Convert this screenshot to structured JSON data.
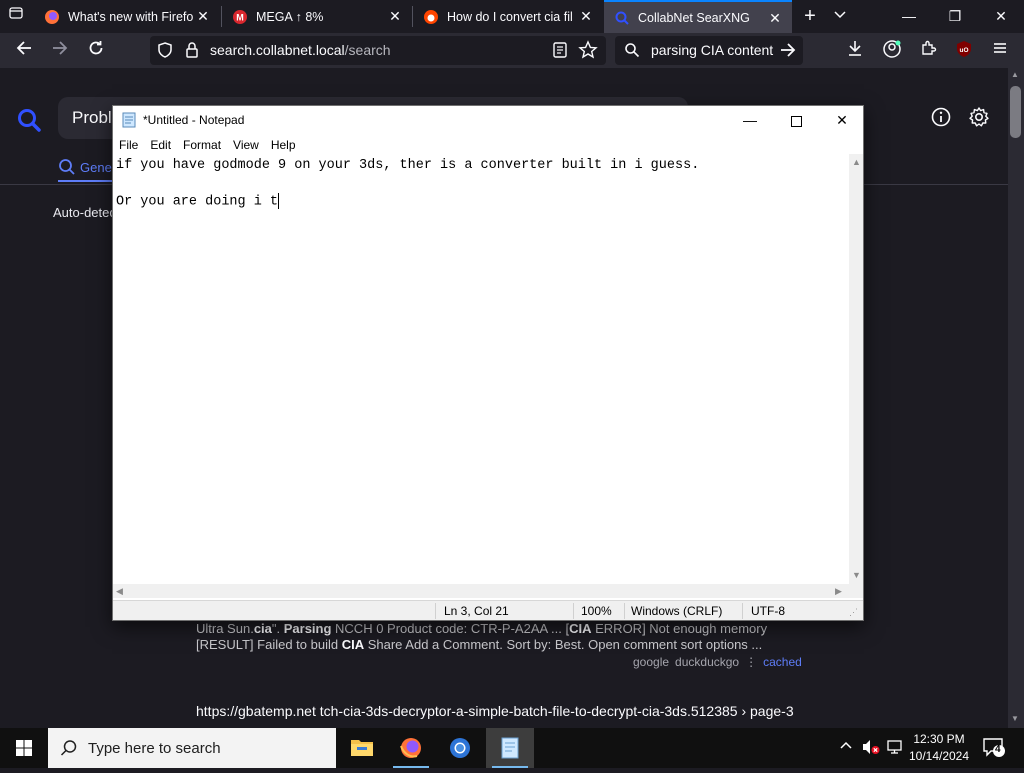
{
  "browser": {
    "tabs": [
      {
        "label": "What's new with Firefox",
        "favicon": "firefox-icon",
        "active": false
      },
      {
        "label": "MEGA ↑ 8%",
        "favicon": "mega-icon",
        "active": false
      },
      {
        "label": "How do I convert cia files",
        "favicon": "reddit-icon",
        "active": false
      },
      {
        "label": "CollabNet SearXNG",
        "favicon": "searxng-icon",
        "active": true
      }
    ],
    "url_host": "search.collabnet.local",
    "url_path": "/search",
    "search_box_value": "parsing CIA content"
  },
  "page": {
    "query_visible": "Proble",
    "tab_general": "Gene",
    "auto_detect": "Auto-detec",
    "result1": {
      "line1_parts": [
        "Ultra Sun.",
        "cia",
        "\". ",
        "Parsing",
        " NCCH 0 Product code: CTR-P-A2AA ... [",
        "CIA",
        " ERROR] Not enough memory"
      ],
      "line2_parts": [
        "[RESULT] Failed to build ",
        "CIA",
        " Share Add a Comment. Sort by: Best. Open comment sort options ..."
      ],
      "engines": [
        "google",
        "duckduckgo"
      ],
      "cached": "cached"
    },
    "result2_url": "https://gbatemp.net  tch-cia-3ds-decryptor-a-simple-batch-file-to-decrypt-cia-3ds.512385 › page-3"
  },
  "notepad": {
    "title": "*Untitled - Notepad",
    "menu": [
      "File",
      "Edit",
      "Format",
      "View",
      "Help"
    ],
    "lines": [
      "if you have godmode 9 on your 3ds, ther is a converter built in i guess.",
      "",
      "Or you are doing i t"
    ],
    "status": {
      "position": "Ln 3, Col 21",
      "zoom": "100%",
      "line_ending": "Windows (CRLF)",
      "encoding": "UTF-8"
    }
  },
  "taskbar": {
    "search_placeholder": "Type here to search",
    "time": "12:30 PM",
    "date": "10/14/2024",
    "notification_count": "4"
  }
}
